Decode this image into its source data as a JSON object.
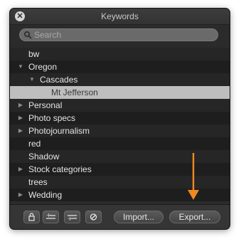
{
  "window": {
    "title": "Keywords"
  },
  "search": {
    "placeholder": "Search"
  },
  "keywords": [
    {
      "label": "bw",
      "level": 0,
      "disclosure": "none",
      "selected": false
    },
    {
      "label": "Oregon",
      "level": 0,
      "disclosure": "expanded",
      "selected": false
    },
    {
      "label": "Cascades",
      "level": 1,
      "disclosure": "expanded",
      "selected": false
    },
    {
      "label": "Mt Jefferson",
      "level": 2,
      "disclosure": "none",
      "selected": true
    },
    {
      "label": "Personal",
      "level": 0,
      "disclosure": "collapsed",
      "selected": false
    },
    {
      "label": "Photo specs",
      "level": 0,
      "disclosure": "collapsed",
      "selected": false
    },
    {
      "label": "Photojournalism",
      "level": 0,
      "disclosure": "collapsed",
      "selected": false
    },
    {
      "label": "red",
      "level": 0,
      "disclosure": "none",
      "selected": false
    },
    {
      "label": "Shadow",
      "level": 0,
      "disclosure": "none",
      "selected": false
    },
    {
      "label": "Stock categories",
      "level": 0,
      "disclosure": "collapsed",
      "selected": false
    },
    {
      "label": "trees",
      "level": 0,
      "disclosure": "none",
      "selected": false
    },
    {
      "label": "Wedding",
      "level": 0,
      "disclosure": "collapsed",
      "selected": false
    }
  ],
  "toolbar": {
    "lock_icon": "lock-icon",
    "add_keyword_icon": "add-keyword-icon",
    "add_subkeyword_icon": "add-subkeyword-icon",
    "remove_icon": "remove-icon",
    "import_label": "Import...",
    "export_label": "Export..."
  },
  "annotation": {
    "arrow_color": "#f0891f"
  }
}
